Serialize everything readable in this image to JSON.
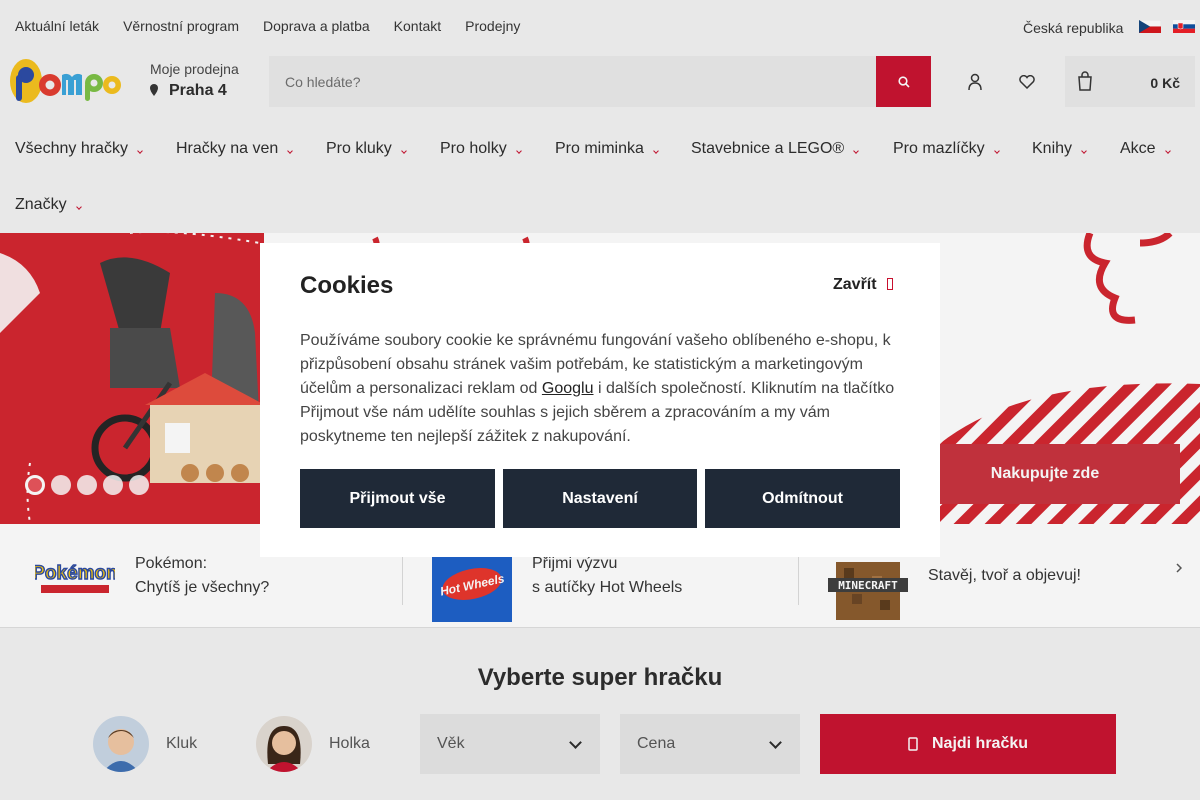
{
  "topbar": {
    "links": [
      "Aktuální leták",
      "Věrnostní program",
      "Doprava a platba",
      "Kontakt",
      "Prodejny"
    ],
    "country": "Česká republika"
  },
  "header": {
    "store_label": "Moje prodejna",
    "store_name": "Praha 4",
    "search_placeholder": "Co hledáte?",
    "cart_total": "0 Kč"
  },
  "nav": {
    "items": [
      "Všechny hračky",
      "Hračky na ven",
      "Pro kluky",
      "Pro holky",
      "Pro miminka",
      "Stavebnice a LEGO®",
      "Pro mazlíčky",
      "Knihy",
      "Akce",
      "Značky"
    ]
  },
  "hero": {
    "cta": "Nakupujte zde",
    "slides": 5,
    "active_slide": 1
  },
  "strip": {
    "items": [
      {
        "line1": "Pokémon:",
        "line2": "Chytíš je všechny?"
      },
      {
        "line1": "Přijmi výzvu",
        "line2": "s autíčky Hot Wheels"
      },
      {
        "line1": "Stavěj, tvoř a objevuj!",
        "line2": ""
      }
    ]
  },
  "finder": {
    "title": "Vyberte super hračku",
    "boy": "Kluk",
    "girl": "Holka",
    "age": "Věk",
    "price": "Cena",
    "find": "Najdi hračku"
  },
  "cookies": {
    "title": "Cookies",
    "close": "Zavřít",
    "text_before": "Používáme soubory cookie ke správnému fungování vašeho oblíbeného e-shopu, k přizpůsobení obsahu stránek vašim potřebám, ke statistickým a marketingovým účelům a personalizaci reklam od",
    "link": "Googlu",
    "text_after": " i dalších společností. Kliknutím na tlačítko Přijmout vše nám udělíte souhlas s jejich sběrem a zpracováním a my vám poskytneme ten nejlepší zážitek z nakupování.",
    "accept": "Přijmout vše",
    "settings": "Nastavení",
    "reject": "Odmítnout"
  },
  "colors": {
    "brand_red": "#c8102e",
    "dark_button": "#1f2937"
  }
}
